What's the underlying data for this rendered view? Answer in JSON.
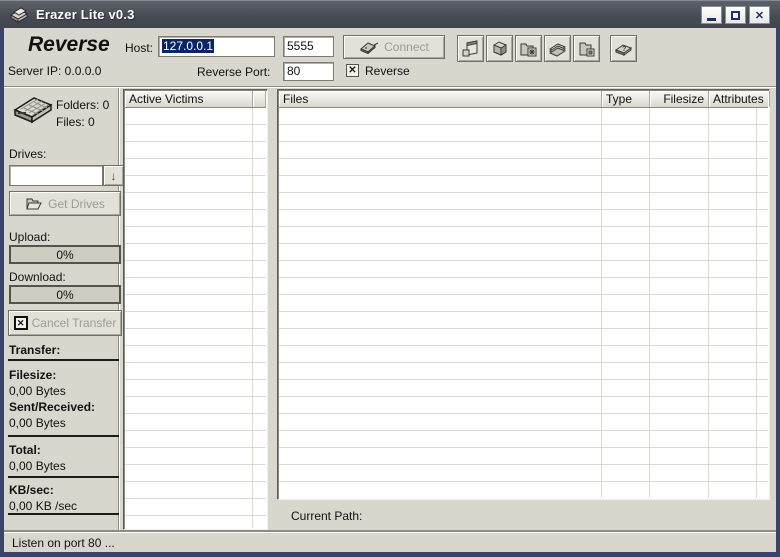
{
  "window": {
    "title": "Erazer Lite v0.3"
  },
  "header": {
    "app_name": "Reverse",
    "server_ip": "Server IP: 0.0.0.0",
    "host_label": "Host:",
    "host_value": "127.0.0.1",
    "port_value": "5555",
    "connect_label": "Connect",
    "reverse_port_label": "Reverse Port:",
    "reverse_port_value": "80",
    "reverse_checkbox_label": "Reverse",
    "reverse_checkbox_checked": true
  },
  "toolbar": {
    "buttons": [
      {
        "name": "new-connection",
        "icon": "window-icon"
      },
      {
        "name": "open-folder",
        "icon": "folder-icon"
      },
      {
        "name": "folder-options",
        "icon": "folder-gear-icon"
      },
      {
        "name": "file-list",
        "icon": "files-stack-icon"
      },
      {
        "name": "folder-save",
        "icon": "folder-save-icon"
      },
      {
        "name": "help",
        "icon": "help-book-icon"
      }
    ]
  },
  "sidebar": {
    "folders_count": "Folders: 0",
    "files_count": "Files: 0",
    "drives_label": "Drives:",
    "drives_value": "",
    "get_drives_label": "Get Drives",
    "upload_label": "Upload:",
    "upload_percent": "0%",
    "download_label": "Download:",
    "download_percent": "0%",
    "cancel_transfer_label": "Cancel Transfer",
    "transfer_label": "Transfer:",
    "filesize_label": "Filesize:",
    "filesize_value": "0,00 Bytes",
    "sent_received_label": "Sent/Received:",
    "sent_received_value": "0,00 Bytes",
    "total_label": "Total:",
    "total_value": "0,00 Bytes",
    "kb_sec_label": "KB/sec:",
    "kb_sec_value": "0,00 KB /sec"
  },
  "victims_list": {
    "header": "Active Victims",
    "rows": []
  },
  "files_list": {
    "columns": [
      "Files",
      "Type",
      "Filesize",
      "Attributes"
    ],
    "rows": [],
    "current_path_label": "Current Path:"
  },
  "status_bar": {
    "text": "Listen on port 80 ..."
  },
  "icons": {
    "close_glyph": "✕",
    "check_glyph": "✕",
    "dropdown_glyph": "↓"
  },
  "colors": {
    "titlebar": "#4a4f57",
    "window_border": "#3a4469",
    "background": "#d9d6ce",
    "selection": "#0a246a",
    "disabled_text": "#9e9b93",
    "grid_line": "#ded9d0"
  }
}
